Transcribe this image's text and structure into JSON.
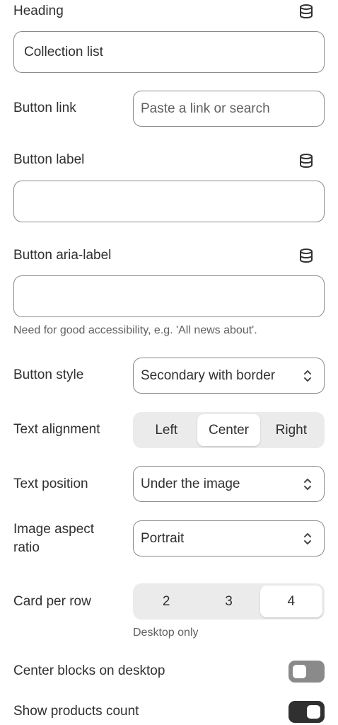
{
  "heading": {
    "label": "Heading",
    "value": "Collection list",
    "icon": "database-icon"
  },
  "button_link": {
    "label": "Button link",
    "placeholder": "Paste a link or search"
  },
  "button_label": {
    "label": "Button label",
    "value": "",
    "icon": "database-icon"
  },
  "button_aria_label": {
    "label": "Button aria-label",
    "value": "",
    "icon": "database-icon",
    "help": "Need for good accessibility, e.g. 'All news about'."
  },
  "button_style": {
    "label": "Button style",
    "selected": "Secondary with border",
    "icon": "chevron-up-down-icon"
  },
  "text_alignment": {
    "label": "Text alignment",
    "options": [
      "Left",
      "Center",
      "Right"
    ],
    "selected": "Center"
  },
  "text_position": {
    "label": "Text position",
    "selected": "Under the image",
    "icon": "chevron-up-down-icon"
  },
  "image_aspect_ratio": {
    "label_line1": "Image aspect",
    "label_line2": "ratio",
    "selected": "Portrait",
    "icon": "chevron-up-down-icon"
  },
  "card_per_row": {
    "label": "Card per row",
    "options": [
      "2",
      "3",
      "4"
    ],
    "selected": "4",
    "help": "Desktop only"
  },
  "center_blocks": {
    "label": "Center blocks on desktop",
    "checked": false
  },
  "show_products_count": {
    "label": "Show products count",
    "checked": true
  },
  "colors": {
    "toggle_off": "#8a8a8a",
    "toggle_on": "#303030",
    "border": "#8a8a8a",
    "segment_bg": "#ebebeb"
  }
}
